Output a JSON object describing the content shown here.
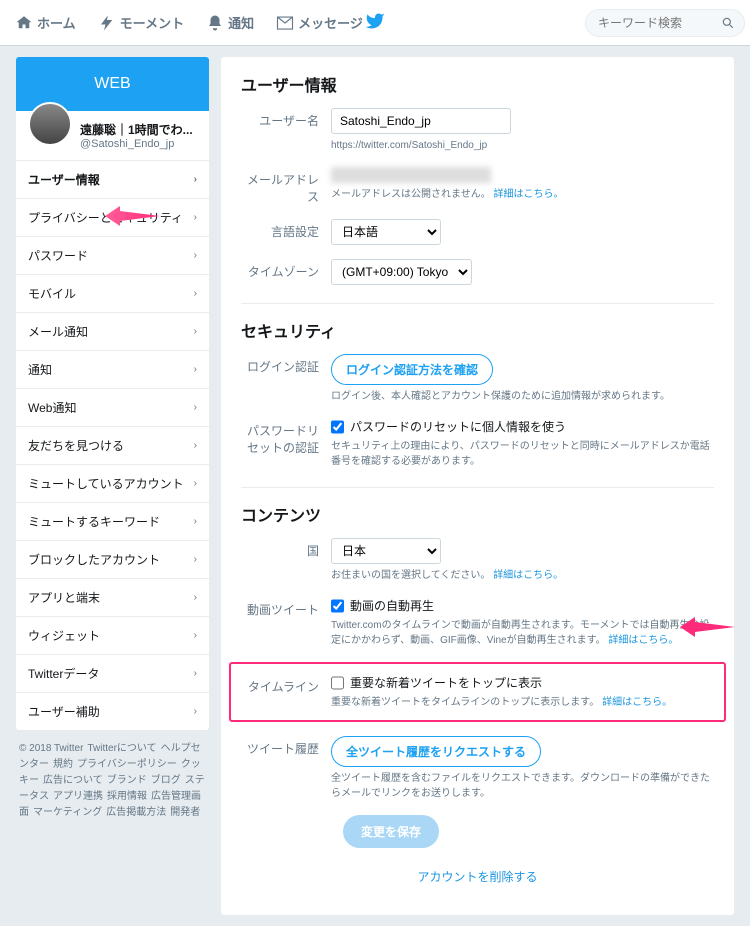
{
  "topnav": {
    "home": "ホーム",
    "moments": "モーメント",
    "notifications": "通知",
    "messages": "メッセージ"
  },
  "search": {
    "placeholder": "キーワード検索"
  },
  "sidebar": {
    "banner": "WEB",
    "profile_name": "遠藤聡｜1時間でわ...",
    "profile_handle": "@Satoshi_Endo_jp",
    "items": [
      "ユーザー情報",
      "プライバシーとセキュリティ",
      "パスワード",
      "モバイル",
      "メール通知",
      "通知",
      "Web通知",
      "友だちを見つける",
      "ミュートしているアカウント",
      "ミュートするキーワード",
      "ブロックしたアカウント",
      "アプリと端末",
      "ウィジェット",
      "Twitterデータ",
      "ユーザー補助"
    ]
  },
  "footer": {
    "copyright": "© 2018 Twitter",
    "links": [
      "Twitterについて",
      "ヘルプセンター",
      "規約",
      "プライバシーポリシー",
      "クッキー",
      "広告について",
      "ブランド",
      "ブログ",
      "ステータス",
      "アプリ連携",
      "採用情報",
      "広告管理画面",
      "マーケティング",
      "広告掲載方法",
      "開発者"
    ]
  },
  "main": {
    "user_section": "ユーザー情報",
    "username_label": "ユーザー名",
    "username_value": "Satoshi_Endo_jp",
    "username_url": "https://twitter.com/Satoshi_Endo_jp",
    "email_label": "メールアドレス",
    "email_note": "メールアドレスは公開されません。",
    "details_link": "詳細はこちら。",
    "lang_label": "言語設定",
    "lang_value": "日本語",
    "tz_label": "タイムゾーン",
    "tz_value": "(GMT+09:00) Tokyo",
    "security_section": "セキュリティ",
    "login_auth_label": "ログイン認証",
    "login_auth_btn": "ログイン認証方法を確認",
    "login_auth_note": "ログイン後、本人確認とアカウント保護のために追加情報が求められます。",
    "pw_reset_label": "パスワードリセットの認証",
    "pw_reset_check": "パスワードのリセットに個人情報を使う",
    "pw_reset_note": "セキュリティ上の理由により、パスワードのリセットと同時にメールアドレスか電話番号を確認する必要があります。",
    "content_section": "コンテンツ",
    "country_label": "国",
    "country_value": "日本",
    "country_note": "お住まいの国を選択してください。",
    "video_label": "動画ツイート",
    "video_check": "動画の自動再生",
    "video_note_1": "Twitter.comのタイムラインで動画が自動再生されます。モーメントでは自動再生の設定にかかわらず、動画、GIF画像、Vineが自動再生されます。",
    "timeline_label": "タイムライン",
    "timeline_check": "重要な新着ツイートをトップに表示",
    "timeline_note": "重要な新着ツイートをタイムラインのトップに表示します。",
    "archive_label": "ツイート履歴",
    "archive_btn": "全ツイート履歴をリクエストする",
    "archive_note": "全ツイート履歴を含むファイルをリクエストできます。ダウンロードの準備ができたらメールでリンクをお送りします。",
    "save_btn": "変更を保存",
    "delete_link": "アカウントを削除する"
  }
}
